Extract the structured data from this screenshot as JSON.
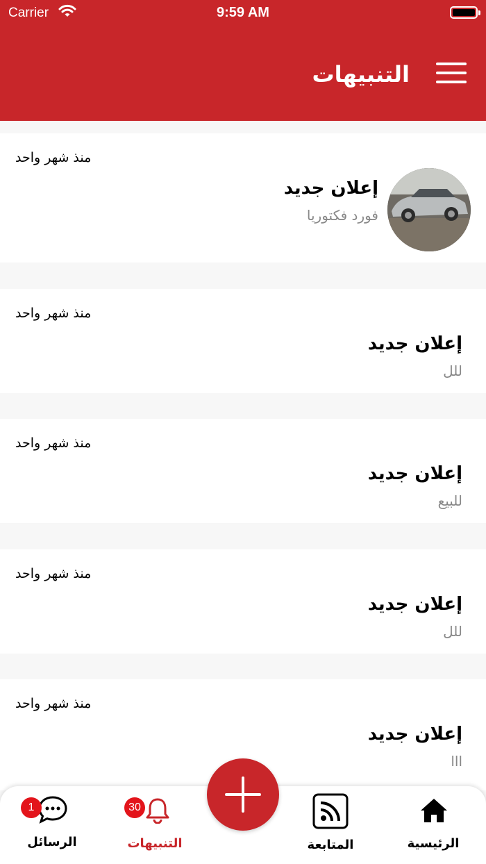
{
  "status_bar": {
    "carrier": "Carrier",
    "time": "9:59 AM"
  },
  "header": {
    "title": "التنبيهات",
    "menu_icon": "hamburger-menu-icon"
  },
  "notifications": [
    {
      "time": "منذ شهر واحد",
      "title": "إعلان جديد",
      "subtitle": "فورد فكتوريا",
      "has_image": true
    },
    {
      "time": "منذ شهر واحد",
      "title": "إعلان جديد",
      "subtitle": "للل",
      "has_image": false
    },
    {
      "time": "منذ شهر واحد",
      "title": "إعلان جديد",
      "subtitle": "للبيع",
      "has_image": false
    },
    {
      "time": "منذ شهر واحد",
      "title": "إعلان جديد",
      "subtitle": "للل",
      "has_image": false
    },
    {
      "time": "منذ شهر واحد",
      "title": "إعلان جديد",
      "subtitle": "ااا",
      "has_image": false
    }
  ],
  "tab_bar": {
    "messages": {
      "label": "الرسائل",
      "badge": "1",
      "icon": "chat-bubble-icon"
    },
    "notifications": {
      "label": "التنبيهات",
      "badge": "30",
      "icon": "bell-icon"
    },
    "add": {
      "icon": "plus-icon"
    },
    "following": {
      "label": "المتابعة",
      "icon": "rss-feed-icon"
    },
    "home": {
      "label": "الرئيسية",
      "icon": "home-icon"
    }
  },
  "colors": {
    "brand": "#c8262a",
    "badge": "#e3141b",
    "subtitle": "#888888"
  }
}
